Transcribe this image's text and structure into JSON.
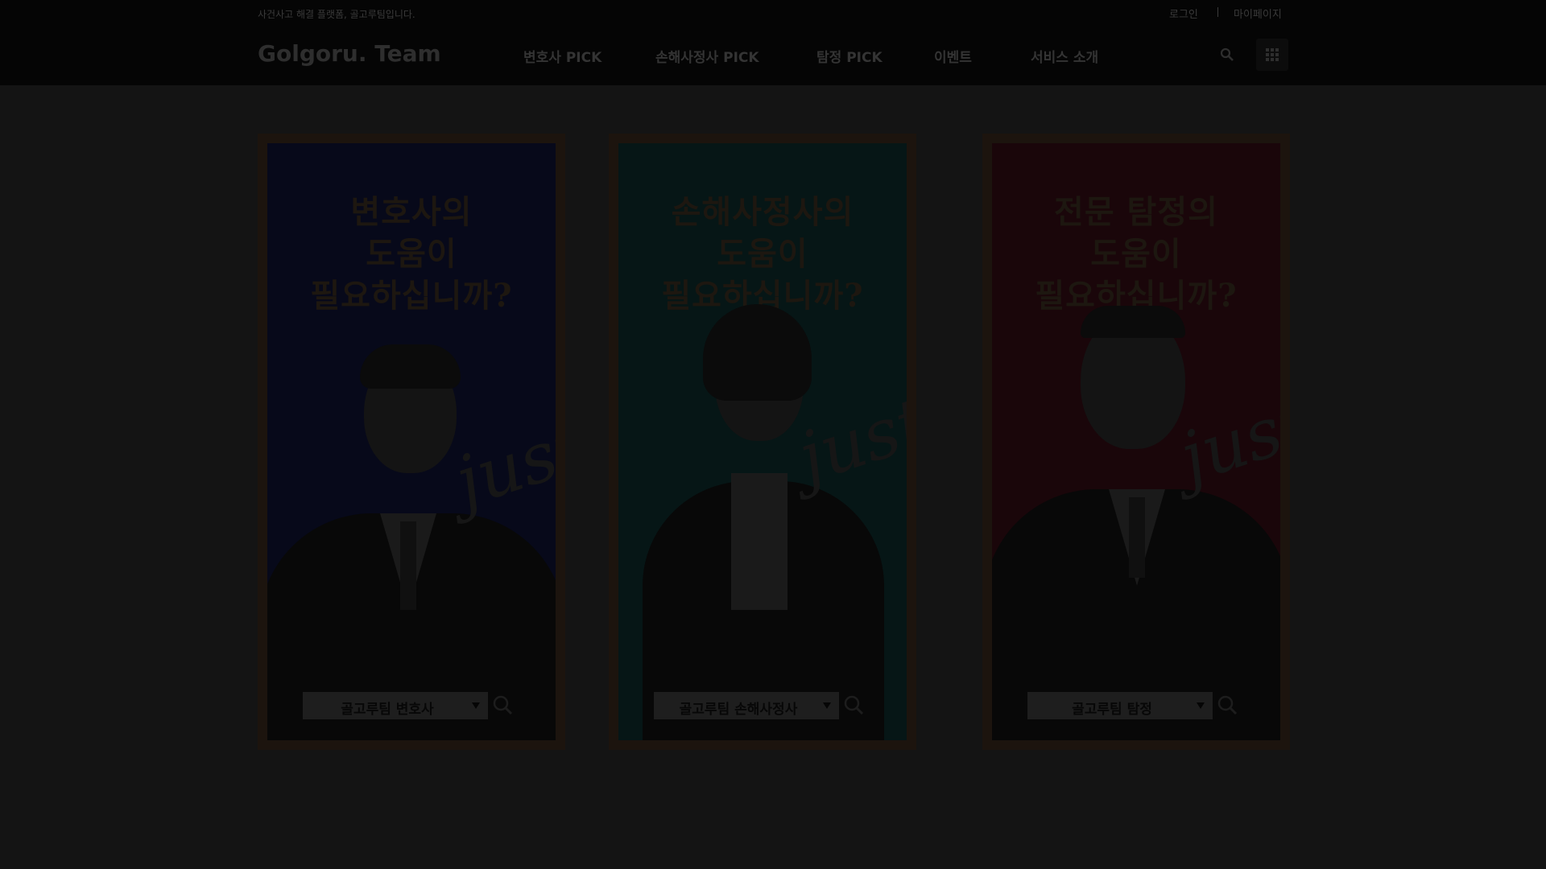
{
  "header": {
    "tagline": "사건사고 해결 플랫폼, 골고루팀입니다.",
    "login_label": "로그인",
    "mypage_label": "마이페이지",
    "logo": "Golgoru. Team",
    "nav": [
      {
        "label": "변호사 PICK"
      },
      {
        "label": "손해사정사 PICK"
      },
      {
        "label": "탐정 PICK"
      },
      {
        "label": "이벤트"
      },
      {
        "label": "서비스 소개"
      }
    ],
    "search_icon": "search-icon",
    "menu_icon": "grid-menu-icon"
  },
  "cards": [
    {
      "title_lines": [
        "변호사의",
        "도움이",
        "필요하십니까?"
      ],
      "select_value": "골고루팀 변호사",
      "bg_color": "#07091a",
      "script_text": "justice"
    },
    {
      "title_lines": [
        "손해사정사의",
        "도움이",
        "필요하십니까?"
      ],
      "select_value": "골고루팀 손해사정사",
      "bg_color": "#061616",
      "script_text": "justice"
    },
    {
      "title_lines": [
        "전문 탐정의",
        "도움이",
        "필요하십니까?"
      ],
      "select_value": "골고루팀 탐정",
      "bg_color": "#1a060a",
      "script_text": "justice"
    }
  ],
  "overlay_color": "#000000"
}
